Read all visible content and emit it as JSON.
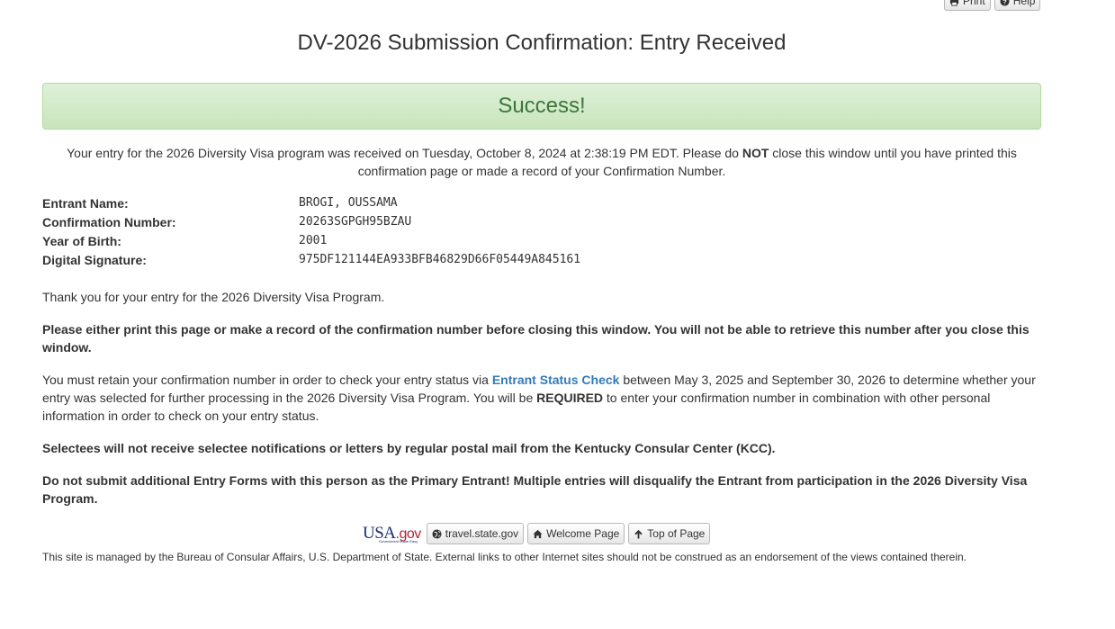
{
  "toolbar": {
    "print_label": "Print",
    "help_label": "Help"
  },
  "title": "DV-2026 Submission Confirmation: Entry Received",
  "success": "Success!",
  "received": {
    "text_a": "Your entry for the 2026 Diversity Visa program was received on Tuesday, October 8, 2024 at 2:38:19 PM EDT. Please do ",
    "emph": "NOT",
    "text_b": " close this window until you have printed this confirmation page or made a record of your Confirmation Number."
  },
  "details": {
    "entrant_name": {
      "label": "Entrant Name:",
      "value": "BROGI, OUSSAMA"
    },
    "confirmation_number": {
      "label": "Confirmation Number:",
      "value": "20263SGPGH95BZAU"
    },
    "year_of_birth": {
      "label": "Year of Birth:",
      "value": "2001"
    },
    "digital_signature": {
      "label": "Digital Signature:",
      "value": "975DF121144EA933BFB46829D66F05449A845161"
    }
  },
  "thanks": "Thank you for your entry for the 2026 Diversity Visa Program.",
  "print_warning": "Please either print this page or make a record of the confirmation number before closing this window. You will not be able to retrieve this number after you close this window.",
  "retain": {
    "text_a": "You must retain your confirmation number in order to check your entry status via ",
    "link": "Entrant Status Check",
    "text_b": " between May 3, 2025 and September 30, 2026 to determine whether your entry was selected for further processing in the 2026 Diversity Visa Program. You will be ",
    "emph": "REQUIRED",
    "text_c": " to enter your confirmation number in combination with other personal information in order to check on your entry status."
  },
  "selectees_notice": "Selectees will not receive selectee notifications or letters by regular postal mail from the Kentucky Consular Center (KCC).",
  "multiple_entries_notice": "Do not submit additional Entry Forms with this person as the Primary Entrant! Multiple entries will disqualify the Entrant from participation in the 2026 Diversity Visa Program.",
  "footer": {
    "usa_logo_main": "USA",
    "usa_logo_gov": ".gov",
    "usa_logo_sub": "Government Made Easy",
    "travel_label": "travel.state.gov",
    "welcome_label": "Welcome Page",
    "top_label": "Top of Page",
    "disclaimer": "This site is managed by the Bureau of Consular Affairs, U.S. Department of State. External links to other Internet sites should not be construed as an endorsement of the views contained therein."
  },
  "icons": [
    "print-icon",
    "help-icon",
    "globe-icon",
    "home-icon",
    "arrow-up-icon"
  ]
}
